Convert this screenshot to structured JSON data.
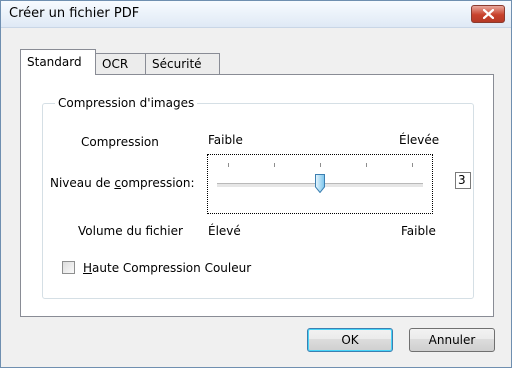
{
  "window": {
    "title": "Créer un fichier PDF"
  },
  "tabs": [
    {
      "label": "Standard",
      "active": true
    },
    {
      "label": "OCR",
      "active": false
    },
    {
      "label": "Sécurité",
      "active": false
    }
  ],
  "group": {
    "legend": "Compression d'images",
    "compression_label": "Compression",
    "compression_low": "Faible",
    "compression_high": "Élevée",
    "level_label_pre": "Niveau de ",
    "level_label_mnemonic": "c",
    "level_label_post": "ompression:",
    "slider_value": "3",
    "slider_min": 1,
    "slider_max": 5,
    "file_size_label": "Volume du fichier",
    "file_size_high": "Élevé",
    "file_size_low": "Faible",
    "checkbox_mnemonic": "H",
    "checkbox_label_rest": "aute Compression Couleur",
    "checkbox_checked": false
  },
  "buttons": {
    "ok": "OK",
    "cancel": "Annuler"
  },
  "colors": {
    "close_button": "#c8422d",
    "focus_border": "#3c7fb1"
  },
  "icons": {
    "close": "close-icon",
    "thumb": "slider-thumb"
  }
}
